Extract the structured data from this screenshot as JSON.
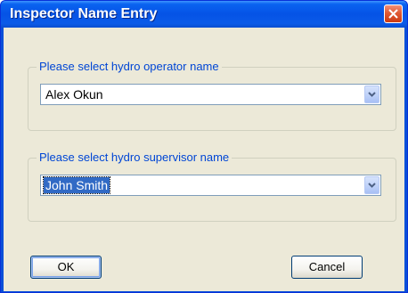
{
  "window": {
    "title": "Inspector Name Entry"
  },
  "operator": {
    "label": "Please select hydro operator name",
    "value": "Alex Okun"
  },
  "supervisor": {
    "label": "Please select hydro supervisor name",
    "value": "John Smith"
  },
  "buttons": {
    "ok": "OK",
    "cancel": "Cancel"
  },
  "icons": {
    "close": "close-icon",
    "dropdown": "chevron-down-icon"
  },
  "colors": {
    "title_bar": "#0553e6",
    "close_button": "#e05a34",
    "group_label": "#0046d5",
    "selection": "#316ac5",
    "dialog_face": "#ece9d8"
  }
}
